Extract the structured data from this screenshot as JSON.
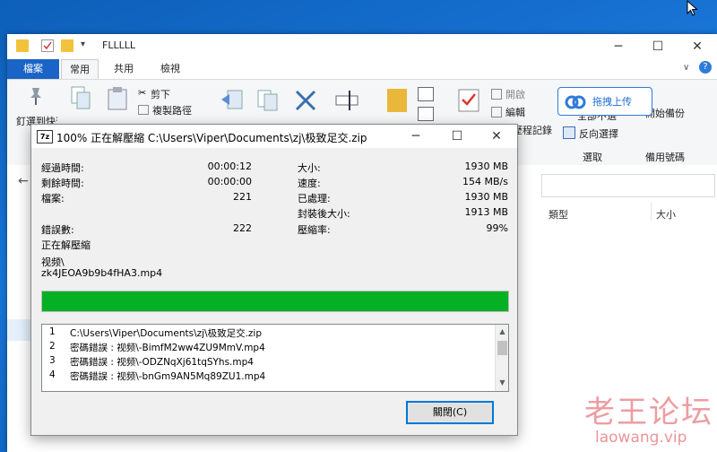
{
  "explorer": {
    "title": "FLLLLL",
    "tabs": [
      "檔案",
      "常用",
      "共用",
      "檢視"
    ],
    "ribbon": {
      "pin_label": "釘選到快速存取",
      "cut_label": "剪下",
      "copy_path_label": "複製路徑",
      "invert_select_label": "反向選擇",
      "select_all_label": "全部不選",
      "open_label": "開啟",
      "edit_label": "編輯",
      "history_label": "歷程記錄",
      "backup_label": "開始備份",
      "group_select": "選取",
      "group_backup": "備用號碼",
      "upload_button": "拖拽上传"
    },
    "columns": {
      "type": "類型",
      "size": "大小"
    }
  },
  "dialog": {
    "title": "100% 正在解壓縮 C:\\Users\\Viper\\Documents\\zj\\极致足交.zip",
    "left_stats": [
      {
        "label": "經過時間:",
        "value": "00:00:12"
      },
      {
        "label": "剩餘時間:",
        "value": "00:00:00"
      },
      {
        "label": "檔案:",
        "value": "221"
      },
      {
        "label": "錯誤數:",
        "value": "222"
      }
    ],
    "right_stats": [
      {
        "label": "大小:",
        "value": "1930 MB"
      },
      {
        "label": "速度:",
        "value": "154 MB/s"
      },
      {
        "label": "已處理:",
        "value": "1930 MB"
      },
      {
        "label": "封裝後大小:",
        "value": "1913 MB"
      },
      {
        "label": "壓縮率:",
        "value": "99%"
      }
    ],
    "status_label": "正在解壓縮",
    "current_path_1": "视频\\",
    "current_path_2": "zk4JEOA9b9b4fHA3.mp4",
    "progress": 1.0,
    "log": [
      {
        "n": "1",
        "text": "C:\\Users\\Viper\\Documents\\zj\\极致足交.zip"
      },
      {
        "n": "2",
        "text": "密碼錯誤 : 视频\\-BimfM2ww4ZU9MmV.mp4"
      },
      {
        "n": "3",
        "text": "密碼錯誤 : 视频\\-ODZNqXj61tqSYhs.mp4"
      },
      {
        "n": "4",
        "text": "密碼錯誤 : 视频\\-bnGm9AN5Mq89ZU1.mp4"
      }
    ],
    "close_label": "關閉(C)"
  },
  "watermark": {
    "text": "老王论坛",
    "url": "laowang.vip"
  },
  "colors": {
    "progress": "#06b025",
    "accent": "#1a64c8"
  }
}
